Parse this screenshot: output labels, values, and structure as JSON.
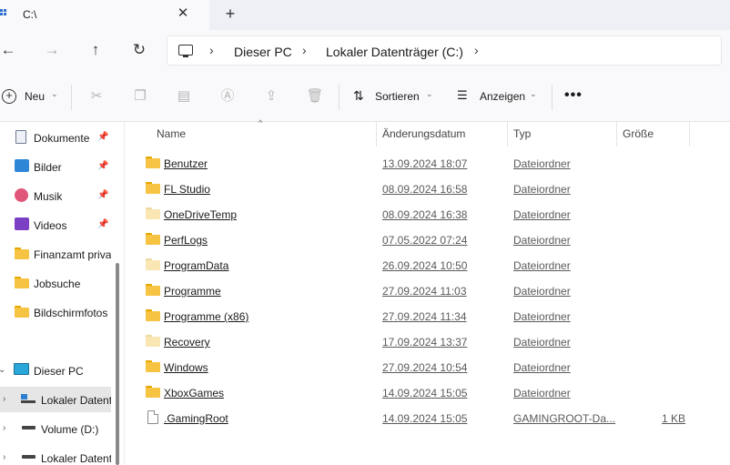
{
  "window": {
    "tab_title": "C:\\",
    "tab_close": "✕",
    "tab_add": "+"
  },
  "nav": {
    "back": "←",
    "forward": "→",
    "up": "↑",
    "refresh": "↻",
    "separator": "›",
    "breadcrumbs": [
      "Dieser PC",
      "Lokaler Datenträger (C:)"
    ]
  },
  "toolbar": {
    "new_label": "Neu",
    "sort_label": "Sortieren",
    "view_label": "Anzeigen",
    "more_label": "•••",
    "icons": [
      "cut-icon",
      "copy-icon",
      "paste-icon",
      "rename-icon",
      "share-icon",
      "delete-icon"
    ]
  },
  "sidebar": {
    "quick_access": [
      {
        "label": "Dokumente",
        "icon": "documents-icon",
        "pinned": true
      },
      {
        "label": "Bilder",
        "icon": "pictures-icon",
        "pinned": true
      },
      {
        "label": "Musik",
        "icon": "music-icon",
        "pinned": true
      },
      {
        "label": "Videos",
        "icon": "videos-icon",
        "pinned": true
      },
      {
        "label": "Finanzamt priva",
        "icon": "folder-icon",
        "pinned": false
      },
      {
        "label": "Jobsuche",
        "icon": "folder-icon",
        "pinned": false
      },
      {
        "label": "Bildschirmfotos",
        "icon": "folder-icon",
        "pinned": false
      }
    ],
    "this_pc": "Dieser PC",
    "drives": [
      {
        "label": "Lokaler Datent",
        "selected": true
      },
      {
        "label": "Volume (D:)",
        "selected": false
      },
      {
        "label": "Lokaler Datent",
        "selected": false
      }
    ]
  },
  "columns": {
    "name": "Name",
    "date": "Änderungsdatum",
    "type": "Typ",
    "size": "Größe"
  },
  "files": [
    {
      "name": "Benutzer",
      "date": "13.09.2024 18:07",
      "type": "Dateiordner",
      "size": "",
      "kind": "folder"
    },
    {
      "name": "FL Studio",
      "date": "08.09.2024 16:58",
      "type": "Dateiordner",
      "size": "",
      "kind": "folder"
    },
    {
      "name": "OneDriveTemp",
      "date": "08.09.2024 16:38",
      "type": "Dateiordner",
      "size": "",
      "kind": "folder-hidden"
    },
    {
      "name": "PerfLogs",
      "date": "07.05.2022 07:24",
      "type": "Dateiordner",
      "size": "",
      "kind": "folder"
    },
    {
      "name": "ProgramData",
      "date": "26.09.2024 10:50",
      "type": "Dateiordner",
      "size": "",
      "kind": "folder-hidden"
    },
    {
      "name": "Programme",
      "date": "27.09.2024 11:03",
      "type": "Dateiordner",
      "size": "",
      "kind": "folder"
    },
    {
      "name": "Programme (x86)",
      "date": "27.09.2024 11:34",
      "type": "Dateiordner",
      "size": "",
      "kind": "folder"
    },
    {
      "name": "Recovery",
      "date": "17.09.2024 13:37",
      "type": "Dateiordner",
      "size": "",
      "kind": "folder-hidden"
    },
    {
      "name": "Windows",
      "date": "27.09.2024 10:54",
      "type": "Dateiordner",
      "size": "",
      "kind": "folder"
    },
    {
      "name": "XboxGames",
      "date": "14.09.2024 15:05",
      "type": "Dateiordner",
      "size": "",
      "kind": "folder"
    },
    {
      "name": ".GamingRoot",
      "date": "14.09.2024 15:05",
      "type": "GAMINGROOT-Da...",
      "size": "1 KB",
      "kind": "file"
    }
  ]
}
